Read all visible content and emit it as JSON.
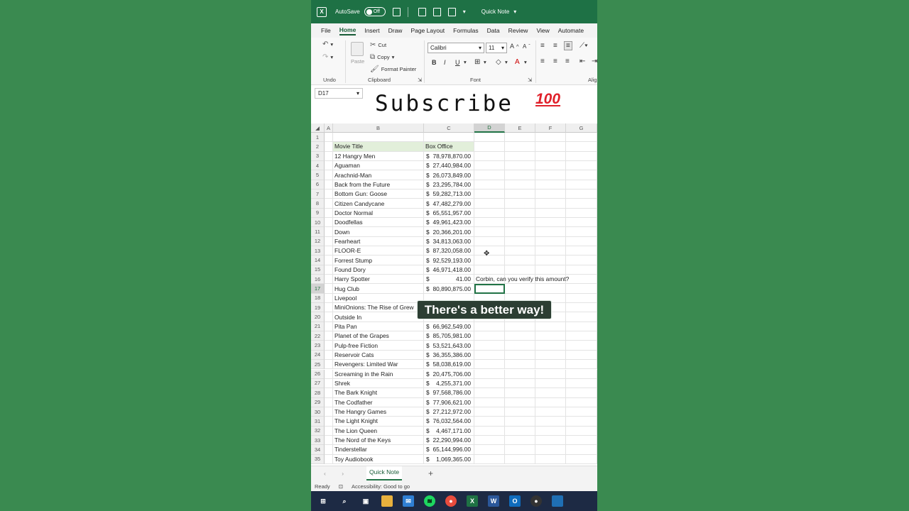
{
  "titlebar": {
    "autosave_label": "AutoSave",
    "autosave_state": "Off",
    "document_name": "Quick Note"
  },
  "tabs": [
    "File",
    "Home",
    "Insert",
    "Draw",
    "Page Layout",
    "Formulas",
    "Data",
    "Review",
    "View",
    "Automate"
  ],
  "ribbon": {
    "undo_label": "Undo",
    "clipboard_label": "Clipboard",
    "font_label": "Font",
    "paste_label": "Paste",
    "cut_label": "Cut",
    "copy_label": "Copy",
    "format_painter_label": "Format Painter",
    "font_name": "Calibri",
    "font_size": "11",
    "alignment_label": "Alig"
  },
  "namebox": "D17",
  "overlay": {
    "subscribe": "Subscribe",
    "emoji": "100",
    "caption": "There's a better way!"
  },
  "columns": [
    "A",
    "B",
    "C",
    "D",
    "E",
    "F",
    "G"
  ],
  "selected_column": "D",
  "headers": {
    "title": "Movie Title",
    "box_office": "Box Office"
  },
  "currency_symbol": "$",
  "rows": [
    {
      "n": "3",
      "title": "12 Hangry Men",
      "amount": "78,978,870.00"
    },
    {
      "n": "4",
      "title": "Aguaman",
      "amount": "27,440,984.00"
    },
    {
      "n": "5",
      "title": "Arachnid-Man",
      "amount": "26,073,849.00"
    },
    {
      "n": "6",
      "title": "Back from the Future",
      "amount": "23,295,784.00"
    },
    {
      "n": "7",
      "title": "Bottom Gun: Goose",
      "amount": "59,282,713.00"
    },
    {
      "n": "8",
      "title": "Citizen Candycane",
      "amount": "47,482,279.00"
    },
    {
      "n": "9",
      "title": "Doctor Normal",
      "amount": "65,551,957.00"
    },
    {
      "n": "10",
      "title": "Doodfellas",
      "amount": "49,961,423.00"
    },
    {
      "n": "11",
      "title": "Down",
      "amount": "20,366,201.00"
    },
    {
      "n": "12",
      "title": "Fearheart",
      "amount": "34,813,063.00"
    },
    {
      "n": "13",
      "title": "FLOOR-E",
      "amount": "87,320,058.00"
    },
    {
      "n": "14",
      "title": "Forrest Stump",
      "amount": "92,529,193.00"
    },
    {
      "n": "15",
      "title": "Found Dory",
      "amount": "46,971,418.00"
    },
    {
      "n": "16",
      "title": "Harry Spotter",
      "amount": "41.00",
      "note": "Corbin, can you verify this amount?"
    },
    {
      "n": "17",
      "title": "Hug Club",
      "amount": "80,890,875.00"
    },
    {
      "n": "18",
      "title": "Livepool",
      "amount": ""
    },
    {
      "n": "19",
      "title": "MiniOnions: The Rise of Grew",
      "amount": ""
    },
    {
      "n": "20",
      "title": "Outside In",
      "amount": ""
    },
    {
      "n": "21",
      "title": "Pita Pan",
      "amount": "66,962,549.00"
    },
    {
      "n": "22",
      "title": "Planet of the Grapes",
      "amount": "85,705,981.00"
    },
    {
      "n": "23",
      "title": "Pulp-free Fiction",
      "amount": "53,521,643.00"
    },
    {
      "n": "24",
      "title": "Reservoir Cats",
      "amount": "36,355,386.00"
    },
    {
      "n": "25",
      "title": "Revengers: Limited War",
      "amount": "58,038,619.00"
    },
    {
      "n": "26",
      "title": "Screaming in the Rain",
      "amount": "20,475,706.00"
    },
    {
      "n": "27",
      "title": "Shrek",
      "amount": "4,255,371.00"
    },
    {
      "n": "28",
      "title": "The Bark Knight",
      "amount": "97,568,786.00"
    },
    {
      "n": "29",
      "title": "The Codfather",
      "amount": "77,906,621.00"
    },
    {
      "n": "30",
      "title": "The Hangry Games",
      "amount": "27,212,972.00"
    },
    {
      "n": "31",
      "title": "The Light Knight",
      "amount": "76,032,564.00"
    },
    {
      "n": "32",
      "title": "The Lion Queen",
      "amount": "4,467,171.00"
    },
    {
      "n": "33",
      "title": "The Nord of the Keys",
      "amount": "22,290,994.00"
    },
    {
      "n": "34",
      "title": "Tinderstellar",
      "amount": "65,144,996.00"
    },
    {
      "n": "35",
      "title": "Toy Audiobook",
      "amount": "1,069,365.00"
    }
  ],
  "sheet_tab": "Quick Note",
  "status": {
    "ready": "Ready",
    "accessibility": "Accessibility: Good to go"
  },
  "colors": {
    "excel_green": "#217346",
    "title_bar": "#1e7145",
    "header_fill": "#e2efda",
    "background": "#3a8a50"
  }
}
